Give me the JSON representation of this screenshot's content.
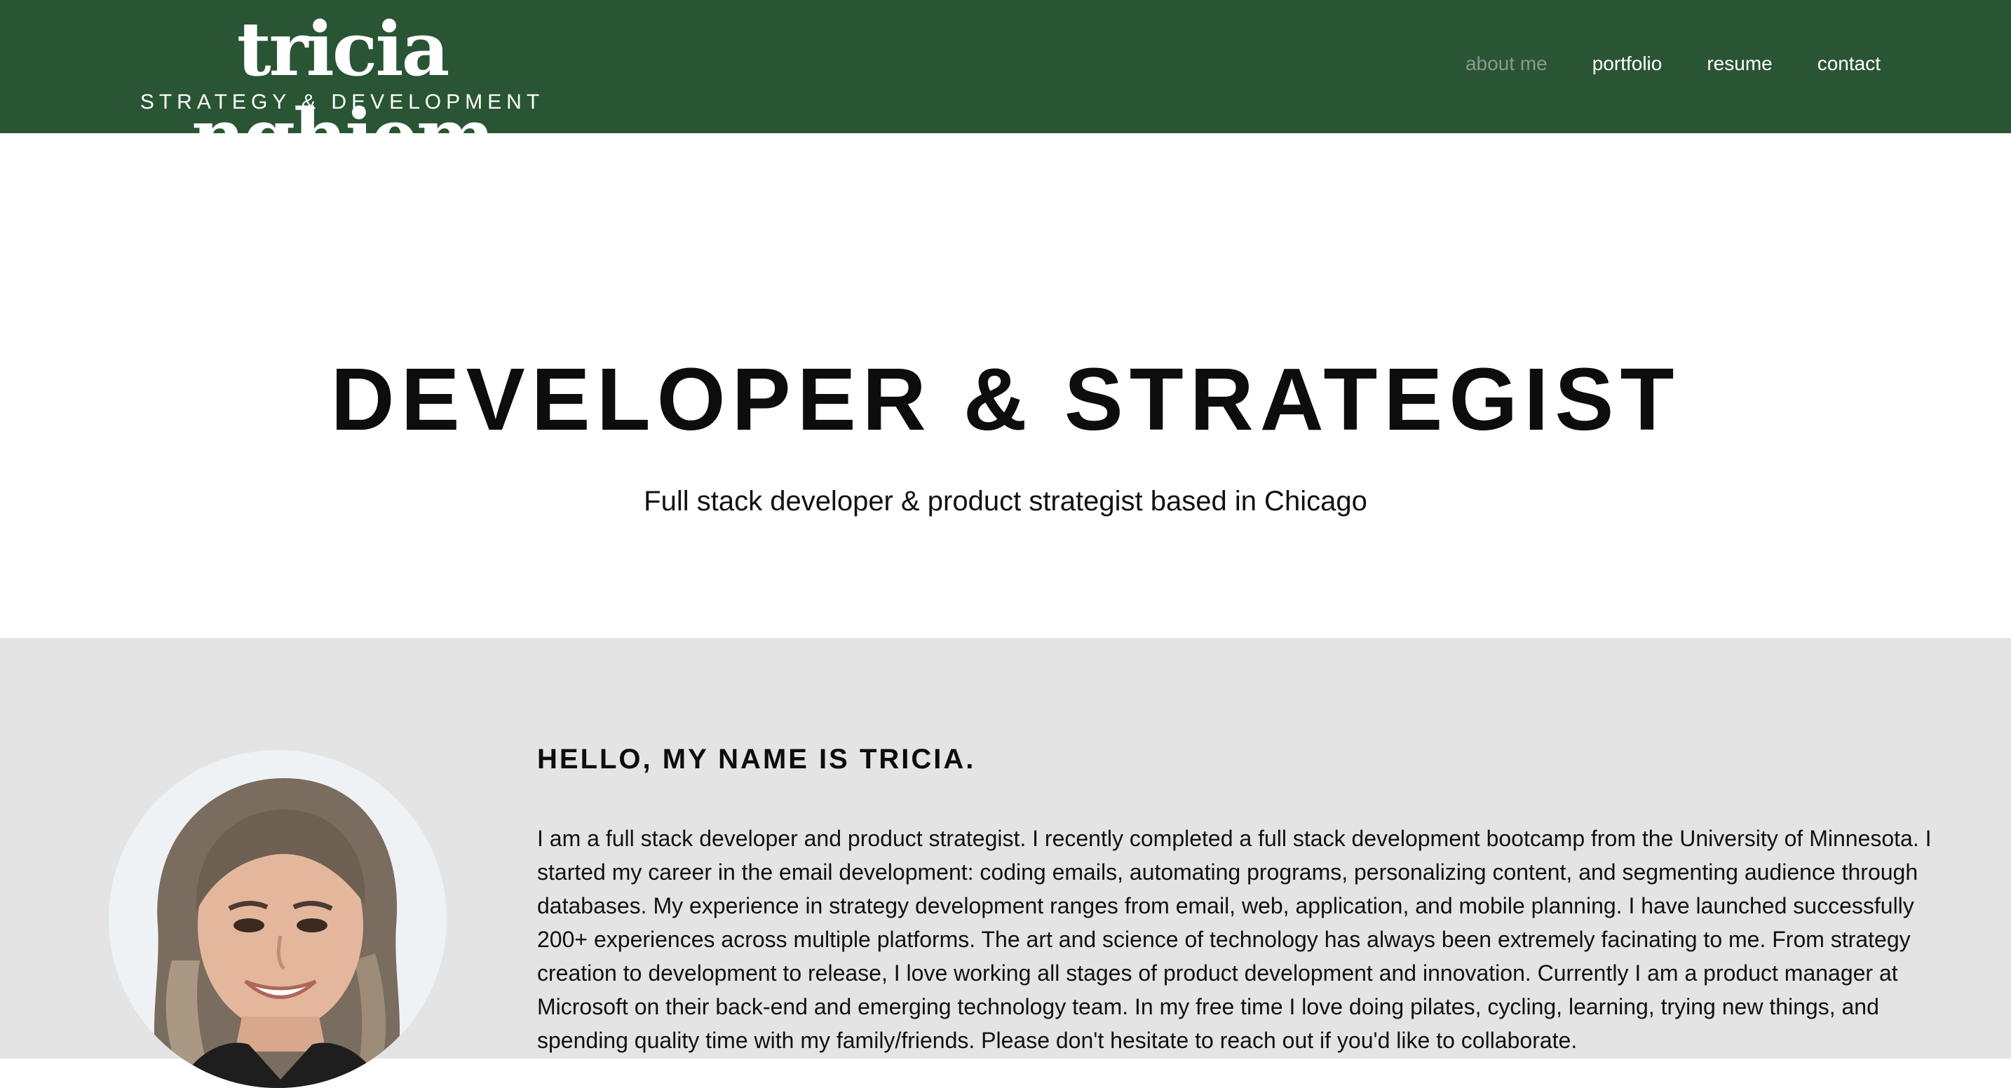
{
  "header": {
    "logo_name": "tricia nghiem",
    "logo_tagline": "STRATEGY & DEVELOPMENT",
    "nav": [
      "about me",
      "portfolio",
      "resume",
      "contact"
    ],
    "active_nav": "about me"
  },
  "hero": {
    "title": "DEVELOPER & STRATEGIST",
    "subtitle": "Full stack developer & product strategist based in Chicago"
  },
  "about": {
    "heading": "HELLO, MY NAME IS TRICIA.",
    "body": "I am a full stack developer and product strategist. I recently completed a full stack development bootcamp from the University of Minnesota. I started my career in the email development: coding emails, automating programs, personalizing content, and segmenting audience through databases. My experience in strategy development ranges from email, web, application, and mobile planning. I have launched successfully 200+ experiences across multiple platforms. The art and science of technology has always been extremely facinating to me. From strategy creation to development to release, I love working all stages of product development and innovation. Currently I am a product manager at Microsoft on their back-end and emerging technology team. In my free time I love doing pilates, cycling, learning, trying new things, and spending quality time with my family/friends. Please don't hesitate to reach out if you'd like to collaborate."
  },
  "colors": {
    "header_bg": "#2a5535",
    "about_bg": "#e4e4e4",
    "nav_active": "#8a9a8e"
  }
}
